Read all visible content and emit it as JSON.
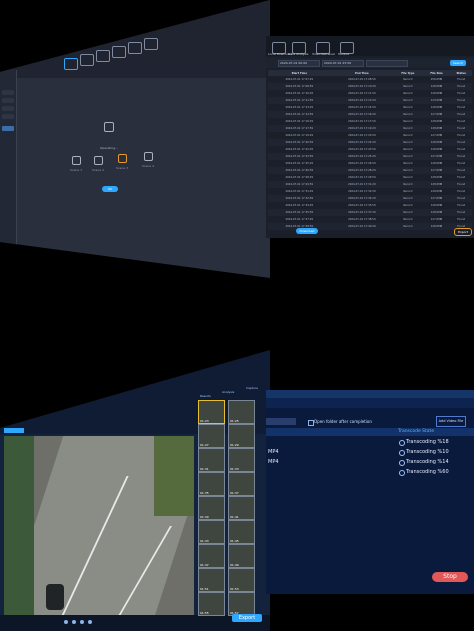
{
  "panel1": {
    "toolbar": [
      "Analysis",
      "Search",
      "Playback",
      "Export",
      "Settings",
      "Tools"
    ],
    "sidebar": [
      "",
      "",
      "",
      "",
      "",
      ""
    ],
    "hint": "Operating...",
    "scenes": [
      "Scene 1",
      "Scene 2",
      "Scene 3",
      "Scene 4"
    ],
    "button": "OK"
  },
  "panel2": {
    "tabs": [
      "Local Download",
      "Data Analysis",
      "Video Retrieval",
      "Toolbox"
    ],
    "filter_values": [
      "2024-07-01 00:00",
      "2024-07-01 23:59"
    ],
    "search_label": "Search",
    "columns": [
      "Start Time",
      "End Time",
      "File Type",
      "File Size",
      "Status"
    ],
    "rows": [
      [
        "2024-07-01 17:07:29",
        "2024-07-01 17:08:59",
        "Record",
        "256.0MB",
        "Found"
      ],
      [
        "2024-07-01 17:08:59",
        "2024-07-01 17:10:29",
        "Record",
        "128.0MB",
        "Found"
      ],
      [
        "2024-07-01 17:10:29",
        "2024-07-01 17:11:59",
        "Record",
        "128.0MB",
        "Found"
      ],
      [
        "2024-07-01 17:11:59",
        "2024-07-01 17:13:29",
        "Record",
        "123.0MB",
        "Found"
      ],
      [
        "2024-07-01 17:13:29",
        "2024-07-01 17:14:59",
        "Record",
        "128.0MB",
        "Found"
      ],
      [
        "2024-07-01 17:14:59",
        "2024-07-01 17:16:29",
        "Record",
        "127.0MB",
        "Found"
      ],
      [
        "2024-07-01 17:16:29",
        "2024-07-01 17:17:59",
        "Record",
        "128.0MB",
        "Found"
      ],
      [
        "2024-07-01 17:17:59",
        "2024-07-01 17:19:29",
        "Record",
        "128.0MB",
        "Found"
      ],
      [
        "2024-07-01 17:19:29",
        "2024-07-01 17:20:59",
        "Record",
        "127.0MB",
        "Found"
      ],
      [
        "2024-07-01 17:20:59",
        "2024-07-01 17:22:29",
        "Record",
        "128.0MB",
        "Found"
      ],
      [
        "2024-07-01 17:22:29",
        "2024-07-01 17:23:59",
        "Record",
        "128.0MB",
        "Found"
      ],
      [
        "2024-07-01 17:23:59",
        "2024-07-01 17:25:29",
        "Record",
        "127.0MB",
        "Found"
      ],
      [
        "2024-07-01 17:25:29",
        "2024-07-01 17:26:59",
        "Record",
        "128.0MB",
        "Found"
      ],
      [
        "2024-07-01 17:26:59",
        "2024-07-01 17:28:29",
        "Record",
        "127.0MB",
        "Found"
      ],
      [
        "2024-07-01 17:28:29",
        "2024-07-01 17:29:59",
        "Record",
        "128.0MB",
        "Found"
      ],
      [
        "2024-07-01 17:29:59",
        "2024-07-01 17:31:29",
        "Record",
        "128.0MB",
        "Found"
      ],
      [
        "2024-07-01 17:31:29",
        "2024-07-01 17:32:59",
        "Record",
        "128.0MB",
        "Found"
      ],
      [
        "2024-07-01 17:32:59",
        "2024-07-01 17:34:29",
        "Record",
        "127.0MB",
        "Found"
      ],
      [
        "2024-07-01 17:34:29",
        "2024-07-01 17:35:59",
        "Record",
        "128.0MB",
        "Found"
      ],
      [
        "2024-07-01 17:35:59",
        "2024-07-01 17:37:29",
        "Record",
        "128.0MB",
        "Found"
      ],
      [
        "2024-07-01 17:37:29",
        "2024-07-01 17:38:59",
        "Record",
        "127.0MB",
        "Found"
      ],
      [
        "2024-07-01 17:38:59",
        "2024-07-01 17:40:29",
        "Record",
        "128.0MB",
        "Found"
      ]
    ],
    "download_label": "Download",
    "export_label": "Export"
  },
  "panel3": {
    "panel_title": "Playback",
    "side_tabs": [
      "Results",
      "Analysis",
      "Capture"
    ],
    "thumb_labels": [
      "01:23",
      "01:25",
      "01:27",
      "01:29",
      "01:31",
      "01:33",
      "01:35",
      "01:37",
      "01:39",
      "01:41",
      "01:43",
      "01:45",
      "01:47",
      "01:49",
      "01:51",
      "01:53",
      "01:55",
      "01:57"
    ],
    "export_label": "Export"
  },
  "panel4": {
    "open_folder_label": "Open folder after completion",
    "add_label": "Add Video File",
    "column_label": "Transcode State",
    "rows": [
      {
        "format": "",
        "state": "Transcoding %18"
      },
      {
        "format": "MP4",
        "state": "Transcoding %10"
      },
      {
        "format": "MP4",
        "state": "Transcoding %14"
      },
      {
        "format": "",
        "state": "Transcoding %60"
      }
    ],
    "stop_label": "Stop"
  },
  "colors": {
    "accent": "#2ea7ff",
    "stop": "#e25757",
    "orange": "#e69a2a"
  }
}
